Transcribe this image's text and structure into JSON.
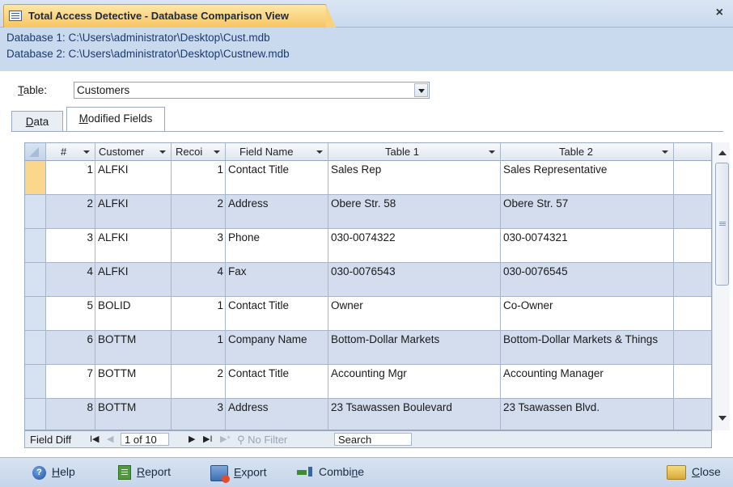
{
  "window": {
    "title": "Total Access Detective - Database Comparison View",
    "close_glyph": "×"
  },
  "databases": {
    "db1": "Database 1: C:\\Users\\administrator\\Desktop\\Cust.mdb",
    "db2": "Database 2: C:\\Users\\administrator\\Desktop\\Custnew.mdb"
  },
  "table_selector": {
    "label_underlined": "T",
    "label_rest": "able:",
    "value": "Customers"
  },
  "tabs": {
    "data_underlined": "D",
    "data_rest": "ata",
    "modified_underlined": "M",
    "modified_rest": "odified Fields"
  },
  "grid": {
    "columns": [
      {
        "label": "#"
      },
      {
        "label": "Customer"
      },
      {
        "label": "Recoi"
      },
      {
        "label": "Field Name"
      },
      {
        "label": "Table 1"
      },
      {
        "label": "Table 2"
      }
    ],
    "rows": [
      {
        "num": "1",
        "customer": "ALFKI",
        "rec": "1",
        "field": "Contact Title",
        "t1": "Sales Rep",
        "t2": "Sales Representative"
      },
      {
        "num": "2",
        "customer": "ALFKI",
        "rec": "2",
        "field": "Address",
        "t1": "Obere Str. 58",
        "t2": "Obere Str. 57"
      },
      {
        "num": "3",
        "customer": "ALFKI",
        "rec": "3",
        "field": "Phone",
        "t1": "030-0074322",
        "t2": "030-0074321"
      },
      {
        "num": "4",
        "customer": "ALFKI",
        "rec": "4",
        "field": "Fax",
        "t1": "030-0076543",
        "t2": "030-0076545"
      },
      {
        "num": "5",
        "customer": "BOLID",
        "rec": "1",
        "field": "Contact Title",
        "t1": "Owner",
        "t2": "Co-Owner"
      },
      {
        "num": "6",
        "customer": "BOTTM",
        "rec": "1",
        "field": "Company Name",
        "t1": "Bottom-Dollar Markets",
        "t2": "Bottom-Dollar Markets & Things"
      },
      {
        "num": "7",
        "customer": "BOTTM",
        "rec": "2",
        "field": "Contact Title",
        "t1": "Accounting Mgr",
        "t2": "Accounting Manager"
      },
      {
        "num": "8",
        "customer": "BOTTM",
        "rec": "3",
        "field": "Address",
        "t1": "23 Tsawassen Boulevard",
        "t2": "23 Tsawassen Blvd."
      }
    ]
  },
  "navigator": {
    "label": "Field Diff",
    "position": "1 of 10",
    "filter": "No Filter",
    "search": "Search"
  },
  "toolbar": {
    "help_u": "H",
    "help_rest": "elp",
    "report_u": "R",
    "report_rest": "eport",
    "export_u": "E",
    "export_rest": "xport",
    "combine_pre": "Combi",
    "combine_u": "n",
    "combine_post": "e",
    "close_u": "C",
    "close_rest": "lose"
  }
}
